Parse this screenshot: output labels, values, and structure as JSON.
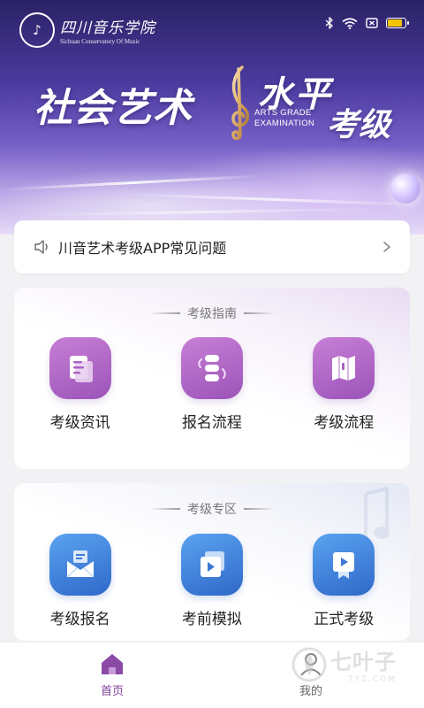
{
  "header": {
    "logo_cn": "四川音乐学院",
    "logo_en": "Sichuan Conservatory Of Music",
    "banner_title_left": "社会艺术",
    "banner_title_right_top": "水平",
    "banner_title_right_bottom": "考级",
    "banner_title_en_1": "ARTS GRADE",
    "banner_title_en_2": "EXAMINATION"
  },
  "status_bar": {
    "icons": [
      "bluetooth-icon",
      "wifi-icon",
      "sim-icon",
      "battery-icon"
    ],
    "battery_level": 0.85
  },
  "notice": {
    "icon": "speaker-icon",
    "text": "川音艺术考级APP常见问题"
  },
  "sections": [
    {
      "title": "考级指南",
      "items": [
        {
          "label": "考级资讯",
          "icon": "news-doc-icon"
        },
        {
          "label": "报名流程",
          "icon": "flow-stack-icon"
        },
        {
          "label": "考级流程",
          "icon": "map-fold-icon"
        }
      ]
    },
    {
      "title": "考级专区",
      "items": [
        {
          "label": "考级报名",
          "icon": "envelope-icon"
        },
        {
          "label": "考前模拟",
          "icon": "video-play-icon"
        },
        {
          "label": "正式考级",
          "icon": "badge-play-icon"
        }
      ]
    }
  ],
  "bottom_nav": {
    "items": [
      {
        "label": "首页",
        "icon": "home-icon",
        "active": true
      },
      {
        "label": "我的",
        "icon": "user-icon",
        "active": false
      }
    ]
  },
  "watermark": {
    "cn": "七叶子",
    "en": "7YZ.COM"
  },
  "colors": {
    "accent_purple": "#9b54b8",
    "accent_blue": "#2f68c9",
    "nav_active": "#7c3e99"
  }
}
